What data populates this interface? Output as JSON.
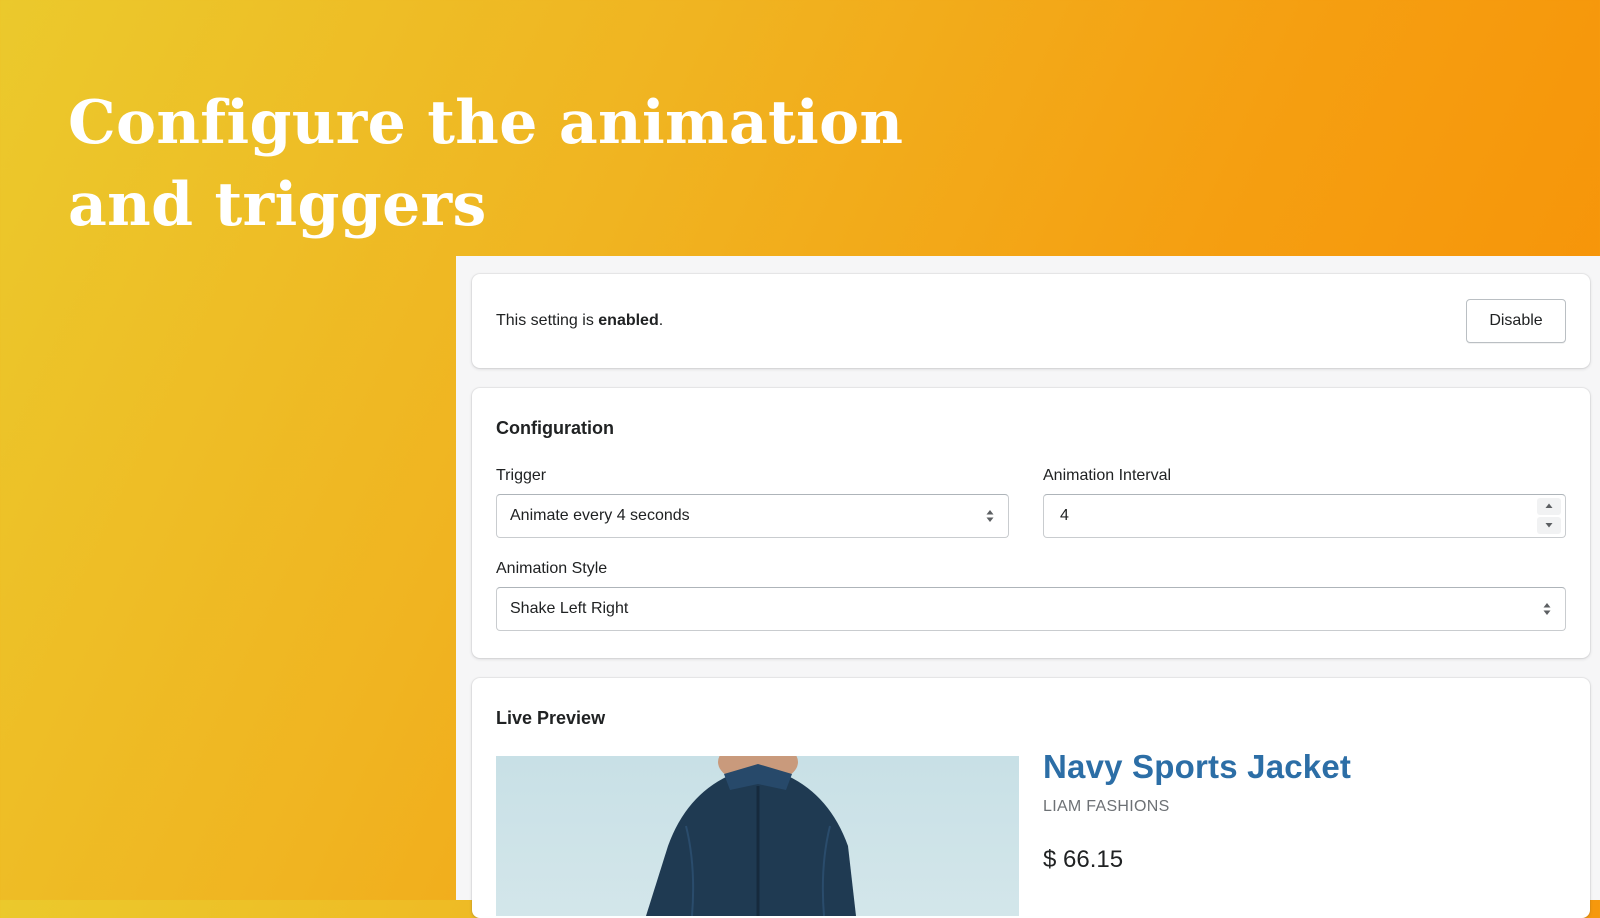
{
  "headline": {
    "line1": "Configure the animation",
    "line2": "and triggers"
  },
  "status_card": {
    "text_prefix": "This setting is ",
    "state": "enabled",
    "text_suffix": ".",
    "disable_label": "Disable"
  },
  "configuration": {
    "title": "Configuration",
    "trigger_label": "Trigger",
    "trigger_value": "Animate every 4 seconds",
    "interval_label": "Animation Interval",
    "interval_value": "4",
    "style_label": "Animation Style",
    "style_value": "Shake Left Right"
  },
  "live_preview": {
    "title": "Live Preview",
    "product_name": "Navy Sports Jacket",
    "vendor": "LIAM FASHIONS",
    "price": "$ 66.15"
  },
  "colors": {
    "gradient_start": "#ebc92c",
    "gradient_end": "#f88f05",
    "product_title": "#2c6ea6",
    "jacket": "#1f3a52"
  }
}
